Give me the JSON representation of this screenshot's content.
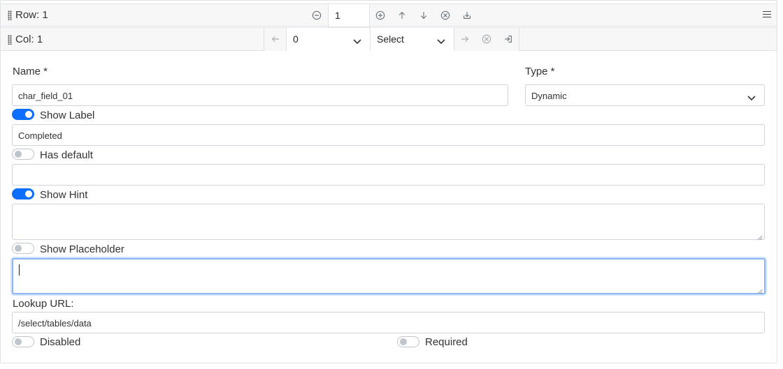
{
  "row_bar": {
    "label": "Row: 1",
    "value": "1",
    "icons": [
      "minus-circle-icon",
      "plus-circle-icon",
      "arrow-up-icon",
      "arrow-down-icon",
      "x-circle-icon",
      "download-icon",
      "menu-icon"
    ]
  },
  "col_bar": {
    "label": "Col: 1",
    "width_select": "0",
    "type_select": "Select"
  },
  "form": {
    "name_label": "Name *",
    "name_value": "char_field_01",
    "type_label": "Type *",
    "type_value": "Dynamic",
    "show_label_text": "Show Label",
    "show_label_on": true,
    "label_value": "Completed",
    "has_default_text": "Has default",
    "has_default_on": false,
    "default_value": "",
    "show_hint_text": "Show Hint",
    "show_hint_on": true,
    "hint_value": "",
    "show_placeholder_text": "Show Placeholder",
    "show_placeholder_on": false,
    "placeholder_value": "",
    "lookup_url_label": "Lookup URL:",
    "lookup_url_value": "/select/tables/data",
    "disabled_text": "Disabled",
    "disabled_on": false,
    "required_text": "Required",
    "required_on": false
  },
  "colors": {
    "accent": "#0d6efd",
    "bar_bg": "#f7f7f8",
    "border": "#ced4da",
    "focus": "#8db4f7"
  }
}
